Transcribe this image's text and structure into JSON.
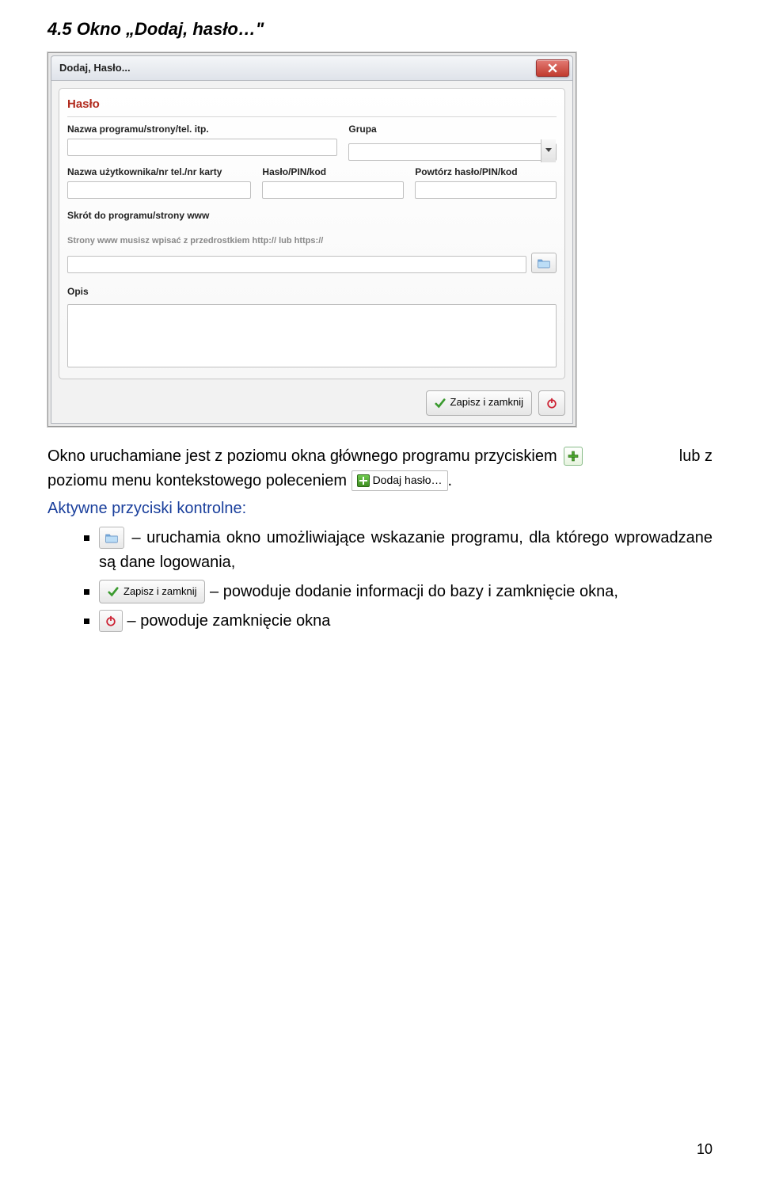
{
  "doc": {
    "section_heading": "4.5 Okno „Dodaj, hasło…\"",
    "page_number": "10"
  },
  "dialog": {
    "window_title": "Dodaj, Hasło...",
    "panel_title": "Hasło",
    "labels": {
      "name": "Nazwa programu/strony/tel. itp.",
      "group": "Grupa",
      "user": "Nazwa użytkownika/nr tel./nr karty",
      "pass": "Hasło/PIN/kod",
      "repeat": "Powtórz hasło/PIN/kod",
      "shortcut": "Skrót do programu/strony www",
      "shortcut_hint": "Strony www musisz wpisać z przedrostkiem http:// lub https://",
      "desc": "Opis"
    },
    "buttons": {
      "save": "Zapisz i zamknij"
    }
  },
  "body": {
    "para1_part1": "Okno uruchamiane jest z poziomu okna głównego programu przyciskiem ",
    "para1_part2": " lub z ",
    "para2_part1": "poziomu menu kontekstowego poleceniem ",
    "menu_item": "Dodaj hasło…",
    "para2_part2": ".",
    "aktywne": "Aktywne przyciski kontrolne:",
    "bullet1_part1": " – uruchamia okno umożliwiające wskazanie programu, dla którego wprowadzane są dane logowania,",
    "bullet2_label": "Zapisz i zamknij",
    "bullet2_rest": " – powoduje dodanie informacji do bazy i zamknięcie okna,",
    "bullet3_rest": " – powoduje zamknięcie okna"
  }
}
